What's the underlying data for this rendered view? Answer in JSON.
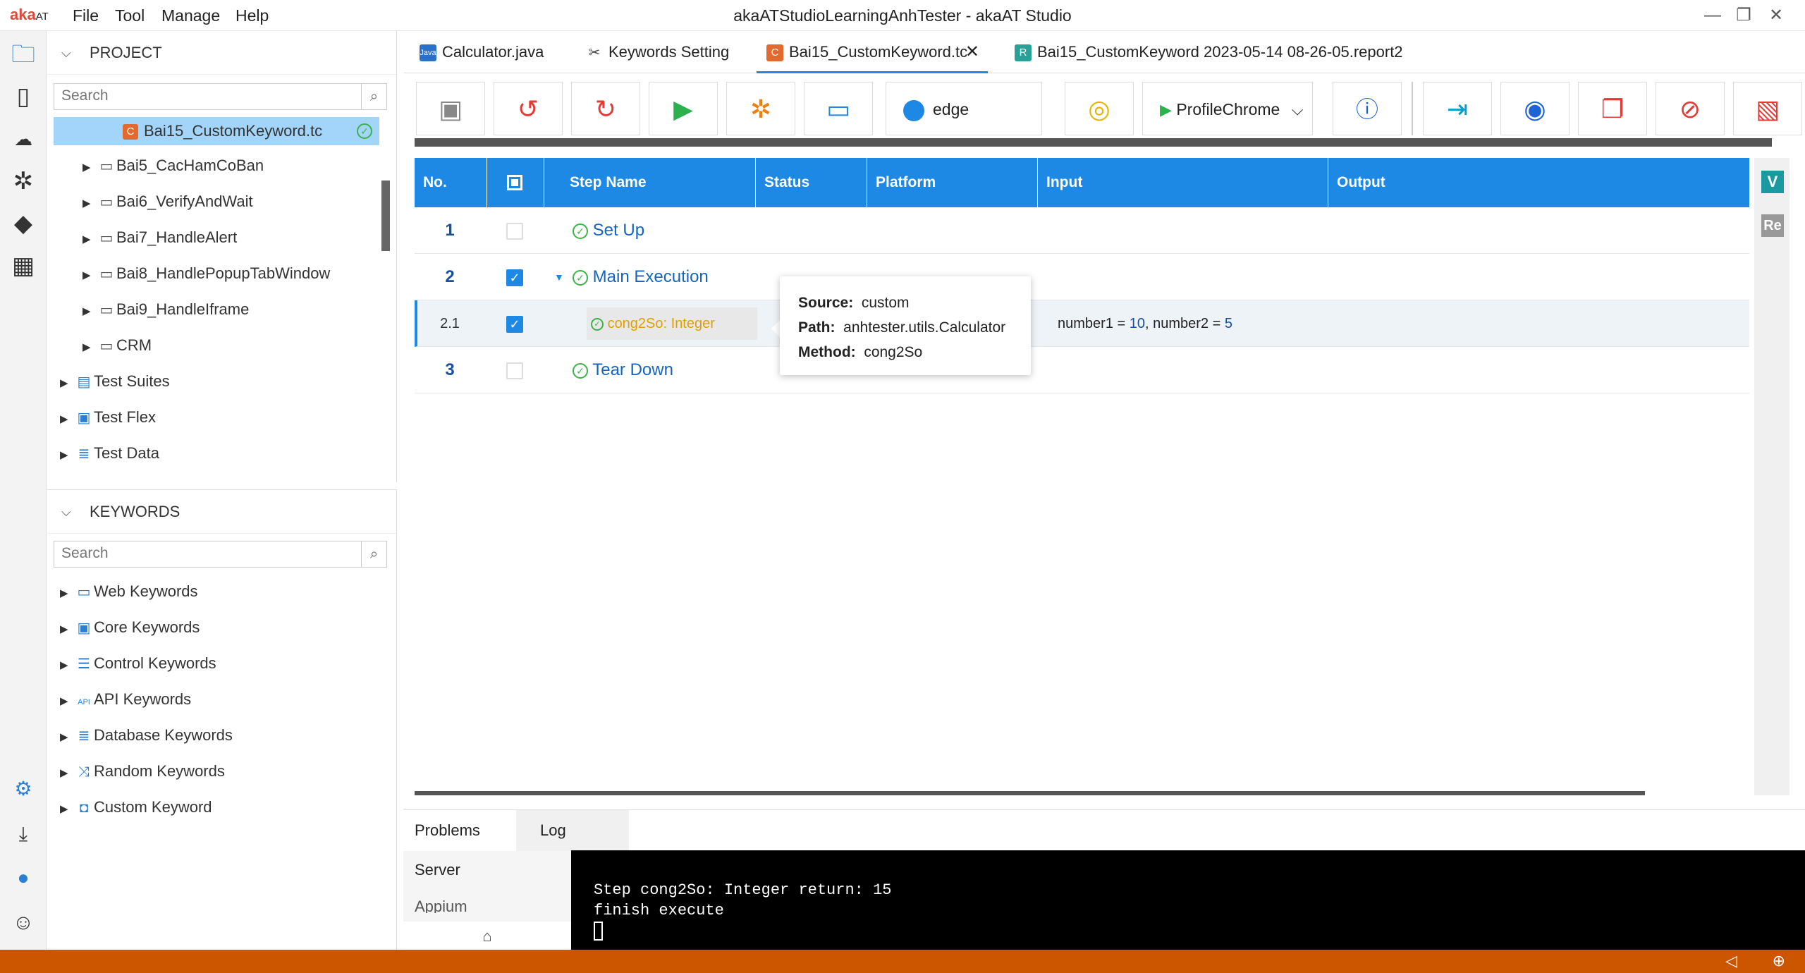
{
  "titlebar": {
    "logo": "aka",
    "logo_suffix": "AT",
    "menus": [
      "File",
      "Tool",
      "Manage",
      "Help"
    ],
    "title": "akaATStudioLearningAnhTester - akaAT Studio"
  },
  "project": {
    "header": "PROJECT",
    "search_placeholder": "Search",
    "selected_file": "Bai15_CustomKeyword.tc",
    "items": [
      "Bai5_CacHamCoBan",
      "Bai6_VerifyAndWait",
      "Bai7_HandleAlert",
      "Bai8_HandlePopupTabWindow",
      "Bai9_HandleIframe",
      "CRM"
    ],
    "roots": [
      "Test Suites",
      "Test Flex",
      "Test Data"
    ]
  },
  "keywords": {
    "header": "KEYWORDS",
    "search_placeholder": "Search",
    "items": [
      "Web Keywords",
      "Core Keywords",
      "Control Keywords",
      "API Keywords",
      "Database Keywords",
      "Random Keywords",
      "Custom Keyword"
    ]
  },
  "tabs": [
    {
      "label": "Calculator.java",
      "icon": "java"
    },
    {
      "label": "Keywords Setting",
      "icon": "tools"
    },
    {
      "label": "Bai15_CustomKeyword.tc",
      "icon": "C",
      "active": true
    },
    {
      "label": "Bai15_CustomKeyword 2023-05-14 08-26-05.report2",
      "icon": "R"
    }
  ],
  "toolbar": {
    "browser": "edge",
    "profile": "ProfileChrome"
  },
  "grid": {
    "columns": [
      "No.",
      "",
      "Step Name",
      "Status",
      "Platform",
      "Input",
      "Output"
    ],
    "rows": [
      {
        "no": "1",
        "name": "Set Up"
      },
      {
        "no": "2",
        "name": "Main Execution"
      },
      {
        "no": "2.1",
        "name": "cong2So: Integer",
        "input_a": "number1",
        "eq": "=",
        "val_a": "10",
        "sep": ",",
        "input_b": "number2",
        "val_b": "5"
      },
      {
        "no": "3",
        "name": "Tear Down"
      }
    ],
    "side_v": "V",
    "side_re": "Re"
  },
  "tooltip": {
    "source_label": "Source:",
    "source": "custom",
    "path_label": "Path:",
    "path": "anhtester.utils.Calculator",
    "method_label": "Method:",
    "method": "cong2So"
  },
  "bottom": {
    "tab_problems": "Problems",
    "tab_log": "Log",
    "server": "Server",
    "appium": "Appium",
    "console_line1": "Step cong2So: Integer return: 15",
    "console_line2": "finish execute"
  },
  "colors": {
    "accent": "#1e88e5",
    "status_bar": "#cc5500",
    "success": "#3cb34a"
  }
}
